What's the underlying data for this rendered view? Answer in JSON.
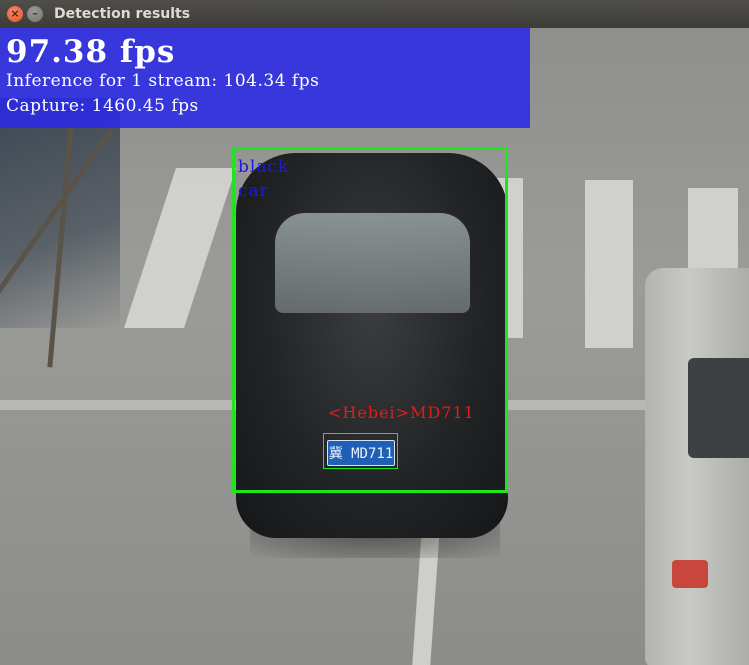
{
  "window": {
    "title": "Detection results",
    "close_glyph": "×",
    "minimize_glyph": "–"
  },
  "stats": {
    "fps": "97.38 fps",
    "inference": "Inference for 1 stream: 104.34 fps",
    "capture": "Capture: 1460.45 fps",
    "panel_color": "#2a2ae6"
  },
  "detections": {
    "vehicle": {
      "color_label": "black",
      "type_label": "car",
      "box_color": "#1ee61e",
      "label_color": "#1a1ae8"
    },
    "license_plate": {
      "recognized_text": "<Hebei>MD711",
      "plate_text": "冀 MD711",
      "label_color": "#e01e1e"
    }
  }
}
